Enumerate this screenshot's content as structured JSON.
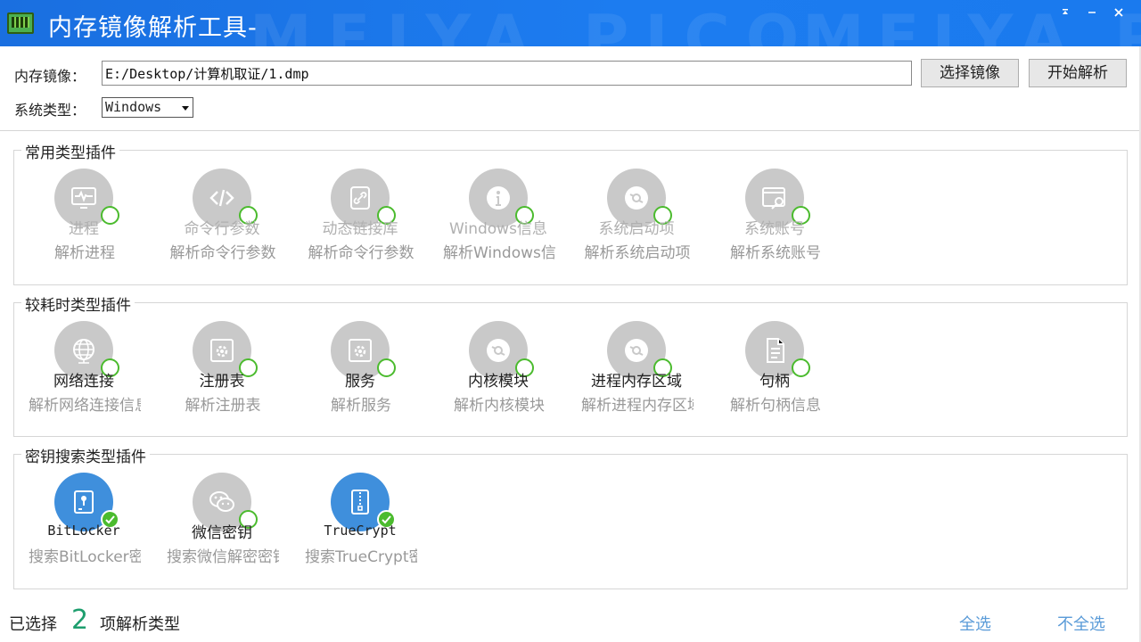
{
  "window": {
    "title": "内存镜像解析工具-",
    "minimize_icon": "minimize-icon",
    "close_icon": "close-icon",
    "accent": "#1c7cf0"
  },
  "form": {
    "image_label": "内存镜像：",
    "image_path": "E:/Desktop/计算机取证/1.dmp",
    "select_image_button": "选择镜像",
    "start_button": "开始解析",
    "os_label": "系统类型：",
    "os_value": "Windows"
  },
  "groups": [
    {
      "title": "常用类型插件",
      "plugins": [
        {
          "name": "进程",
          "desc": "解析进程",
          "icon": "monitor-pulse-icon",
          "selected": false
        },
        {
          "name": "命令行参数",
          "desc": "解析命令行参数",
          "icon": "code-icon",
          "selected": false
        },
        {
          "name": "动态链接库",
          "desc": "解析命令行参数",
          "icon": "link-icon",
          "selected": false
        },
        {
          "name": "Windows信息",
          "desc": "解析Windows信息",
          "icon": "info-icon",
          "selected": false
        },
        {
          "name": "系统启动项",
          "desc": "解析系统启动项",
          "icon": "disc-icon",
          "selected": false
        },
        {
          "name": "系统账号",
          "desc": "解析系统账号",
          "icon": "account-window-icon",
          "selected": false
        }
      ]
    },
    {
      "title": "较耗时类型插件",
      "plugins": [
        {
          "name": "网络连接",
          "desc": "解析网络连接信息",
          "icon": "globe-icon",
          "selected": false
        },
        {
          "name": "注册表",
          "desc": "解析注册表",
          "icon": "gear-window-icon",
          "selected": false
        },
        {
          "name": "服务",
          "desc": "解析服务",
          "icon": "gear-window-icon",
          "selected": false
        },
        {
          "name": "内核模块",
          "desc": "解析内核模块",
          "icon": "disc-icon",
          "selected": false
        },
        {
          "name": "进程内存区域",
          "desc": "解析进程内存区域",
          "icon": "disc-icon",
          "selected": false
        },
        {
          "name": "句柄",
          "desc": "解析句柄信息",
          "icon": "document-icon",
          "selected": false
        }
      ]
    },
    {
      "title": "密钥搜索类型插件",
      "plugins": [
        {
          "name": "BitLocker",
          "desc": "搜索BitLocker密钥",
          "icon": "drive-lock-icon",
          "selected": true
        },
        {
          "name": "微信密钥",
          "desc": "搜索微信解密密钥",
          "icon": "wechat-icon",
          "selected": false
        },
        {
          "name": "TrueCrypt",
          "desc": "搜索TrueCrypt密钥",
          "icon": "zip-file-icon",
          "selected": true
        }
      ]
    }
  ],
  "footer": {
    "selected_prefix": "已选择",
    "selected_count": "2",
    "selected_suffix": "项解析类型",
    "select_all": "全选",
    "select_none": "不全选"
  }
}
